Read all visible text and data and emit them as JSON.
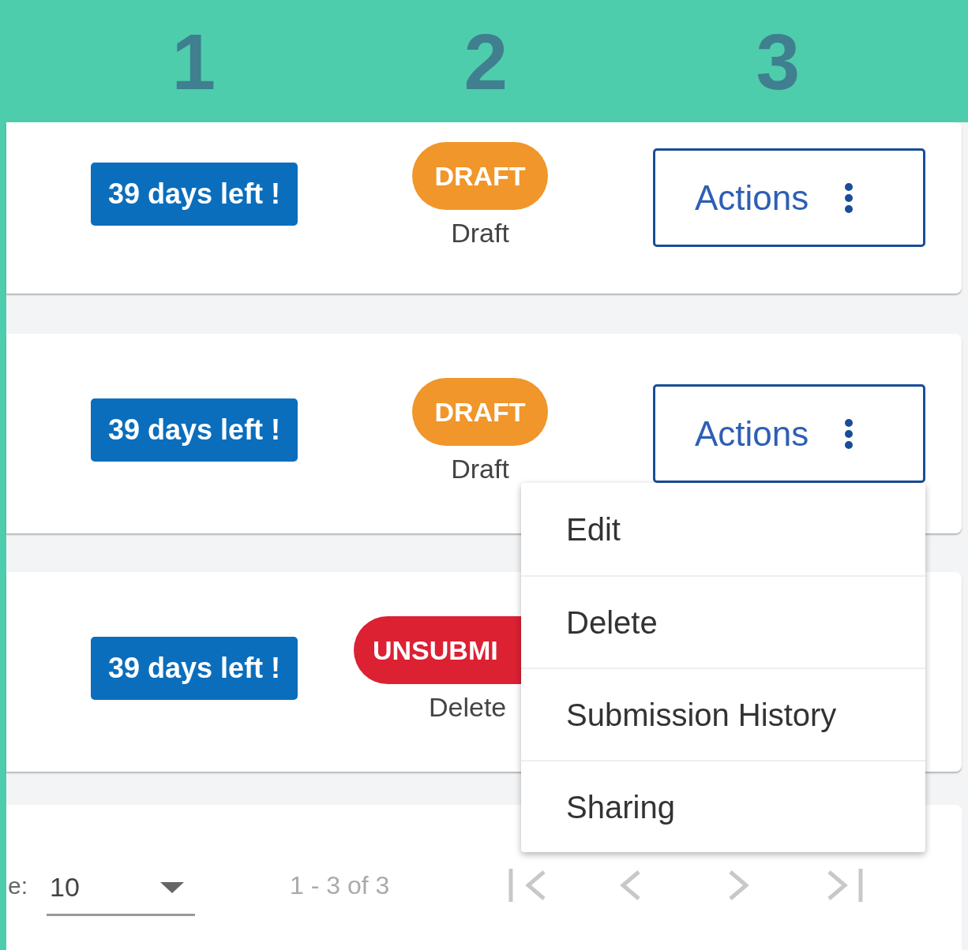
{
  "header": {
    "columns": [
      "1",
      "2",
      "3"
    ]
  },
  "rows": [
    {
      "deadline": "39 days left !",
      "status": {
        "label": "DRAFT",
        "kind": "draft",
        "cut": false
      },
      "sublabel": "Draft",
      "actions": "Actions"
    },
    {
      "deadline": "39 days left !",
      "status": {
        "label": "DRAFT",
        "kind": "draft",
        "cut": false
      },
      "sublabel": "Draft",
      "actions": "Actions"
    },
    {
      "deadline": "39 days left !",
      "status": {
        "label": "UNSUBMI",
        "kind": "unsubmitted",
        "cut": true
      },
      "sublabel": "Delete"
    }
  ],
  "menu": [
    "Edit",
    "Delete",
    "Submission History",
    "Sharing"
  ],
  "pagination": {
    "page_size_label": "e:",
    "page_size": "10",
    "range": "1 - 3 of 3"
  }
}
